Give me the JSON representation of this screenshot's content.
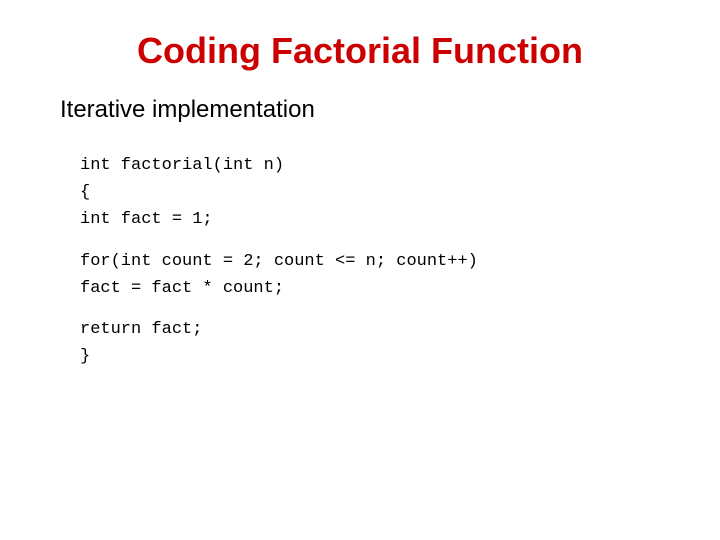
{
  "title": "Coding Factorial Function",
  "subtitle": "Iterative implementation",
  "code": {
    "line1": "int factorial(int n)",
    "line2": "{",
    "line3": " int fact = 1;",
    "line4": "for(int count = 2; count <= n; count++)",
    "line5": "    fact = fact * count;",
    "line6": "return fact;",
    "line7": "}"
  }
}
